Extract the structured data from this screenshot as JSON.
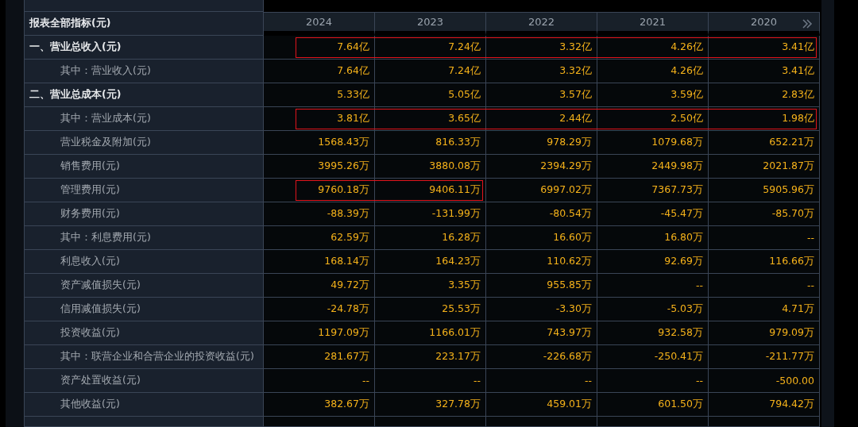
{
  "table": {
    "header_label": "报表全部指标(元)",
    "years": [
      "2024",
      "2023",
      "2022",
      "2021",
      "2020"
    ],
    "rows": [
      {
        "label": "一、营业总收入(元)",
        "kind": "section",
        "cells": [
          {
            "value": "7.64亿",
            "boxed": true
          },
          {
            "value": "7.24亿",
            "boxed": true
          },
          {
            "value": "3.32亿",
            "boxed": true
          },
          {
            "value": "4.26亿",
            "boxed": true
          },
          {
            "value": "3.41亿",
            "boxed": true
          }
        ]
      },
      {
        "label": "其中：营业收入(元)",
        "kind": "item",
        "cells": [
          {
            "value": "7.64亿",
            "boxed": false
          },
          {
            "value": "7.24亿",
            "boxed": false
          },
          {
            "value": "3.32亿",
            "boxed": false
          },
          {
            "value": "4.26亿",
            "boxed": false
          },
          {
            "value": "3.41亿",
            "boxed": false
          }
        ]
      },
      {
        "label": "二、营业总成本(元)",
        "kind": "section",
        "cells": [
          {
            "value": "5.33亿",
            "boxed": false
          },
          {
            "value": "5.05亿",
            "boxed": false
          },
          {
            "value": "3.57亿",
            "boxed": false
          },
          {
            "value": "3.59亿",
            "boxed": false
          },
          {
            "value": "2.83亿",
            "boxed": false
          }
        ]
      },
      {
        "label": "其中：营业成本(元)",
        "kind": "item",
        "cells": [
          {
            "value": "3.81亿",
            "boxed": true
          },
          {
            "value": "3.65亿",
            "boxed": true
          },
          {
            "value": "2.44亿",
            "boxed": true
          },
          {
            "value": "2.50亿",
            "boxed": true
          },
          {
            "value": "1.98亿",
            "boxed": true
          }
        ]
      },
      {
        "label": "营业税金及附加(元)",
        "kind": "item",
        "cells": [
          {
            "value": "1568.43万",
            "boxed": false
          },
          {
            "value": "816.33万",
            "boxed": false
          },
          {
            "value": "978.29万",
            "boxed": false
          },
          {
            "value": "1079.68万",
            "boxed": false
          },
          {
            "value": "652.21万",
            "boxed": false
          }
        ]
      },
      {
        "label": "销售费用(元)",
        "kind": "item",
        "cells": [
          {
            "value": "3995.26万",
            "boxed": false
          },
          {
            "value": "3880.08万",
            "boxed": false
          },
          {
            "value": "2394.29万",
            "boxed": false
          },
          {
            "value": "2449.98万",
            "boxed": false
          },
          {
            "value": "2021.87万",
            "boxed": false
          }
        ]
      },
      {
        "label": "管理费用(元)",
        "kind": "item",
        "cells": [
          {
            "value": "9760.18万",
            "boxed": true
          },
          {
            "value": "9406.11万",
            "boxed": true
          },
          {
            "value": "6997.02万",
            "boxed": false
          },
          {
            "value": "7367.73万",
            "boxed": false
          },
          {
            "value": "5905.96万",
            "boxed": false
          }
        ]
      },
      {
        "label": "财务费用(元)",
        "kind": "item",
        "cells": [
          {
            "value": "-88.39万",
            "boxed": false
          },
          {
            "value": "-131.99万",
            "boxed": false
          },
          {
            "value": "-80.54万",
            "boxed": false
          },
          {
            "value": "-45.47万",
            "boxed": false
          },
          {
            "value": "-85.70万",
            "boxed": false
          }
        ]
      },
      {
        "label": "其中：利息费用(元)",
        "kind": "item",
        "cells": [
          {
            "value": "62.59万",
            "boxed": false
          },
          {
            "value": "16.28万",
            "boxed": false
          },
          {
            "value": "16.60万",
            "boxed": false
          },
          {
            "value": "16.80万",
            "boxed": false
          },
          {
            "value": "--",
            "boxed": false
          }
        ]
      },
      {
        "label": "利息收入(元)",
        "kind": "item",
        "cells": [
          {
            "value": "168.14万",
            "boxed": false
          },
          {
            "value": "164.23万",
            "boxed": false
          },
          {
            "value": "110.62万",
            "boxed": false
          },
          {
            "value": "92.69万",
            "boxed": false
          },
          {
            "value": "116.66万",
            "boxed": false
          }
        ]
      },
      {
        "label": "资产减值损失(元)",
        "kind": "item",
        "cells": [
          {
            "value": "49.72万",
            "boxed": false
          },
          {
            "value": "3.35万",
            "boxed": false
          },
          {
            "value": "955.85万",
            "boxed": false
          },
          {
            "value": "--",
            "boxed": false
          },
          {
            "value": "--",
            "boxed": false
          }
        ]
      },
      {
        "label": "信用减值损失(元)",
        "kind": "item",
        "cells": [
          {
            "value": "-24.78万",
            "boxed": false
          },
          {
            "value": "25.53万",
            "boxed": false
          },
          {
            "value": "-3.30万",
            "boxed": false
          },
          {
            "value": "-5.03万",
            "boxed": false
          },
          {
            "value": "4.71万",
            "boxed": false
          }
        ]
      },
      {
        "label": "投资收益(元)",
        "kind": "item",
        "cells": [
          {
            "value": "1197.09万",
            "boxed": false
          },
          {
            "value": "1166.01万",
            "boxed": false
          },
          {
            "value": "743.97万",
            "boxed": false
          },
          {
            "value": "932.58万",
            "boxed": false
          },
          {
            "value": "979.09万",
            "boxed": false
          }
        ]
      },
      {
        "label": "其中：联营企业和合营企业的投资收益(元)",
        "kind": "item",
        "cells": [
          {
            "value": "281.67万",
            "boxed": false
          },
          {
            "value": "223.17万",
            "boxed": false
          },
          {
            "value": "-226.68万",
            "boxed": false
          },
          {
            "value": "-250.41万",
            "boxed": false
          },
          {
            "value": "-211.77万",
            "boxed": false
          }
        ]
      },
      {
        "label": "资产处置收益(元)",
        "kind": "item",
        "cells": [
          {
            "value": "--",
            "boxed": false
          },
          {
            "value": "--",
            "boxed": false
          },
          {
            "value": "--",
            "boxed": false
          },
          {
            "value": "--",
            "boxed": false
          },
          {
            "value": "-500.00",
            "boxed": false
          }
        ]
      },
      {
        "label": "其他收益(元)",
        "kind": "item",
        "cells": [
          {
            "value": "382.67万",
            "boxed": false
          },
          {
            "value": "327.78万",
            "boxed": false
          },
          {
            "value": "459.01万",
            "boxed": false
          },
          {
            "value": "601.50万",
            "boxed": false
          },
          {
            "value": "794.42万",
            "boxed": false
          }
        ]
      }
    ]
  }
}
